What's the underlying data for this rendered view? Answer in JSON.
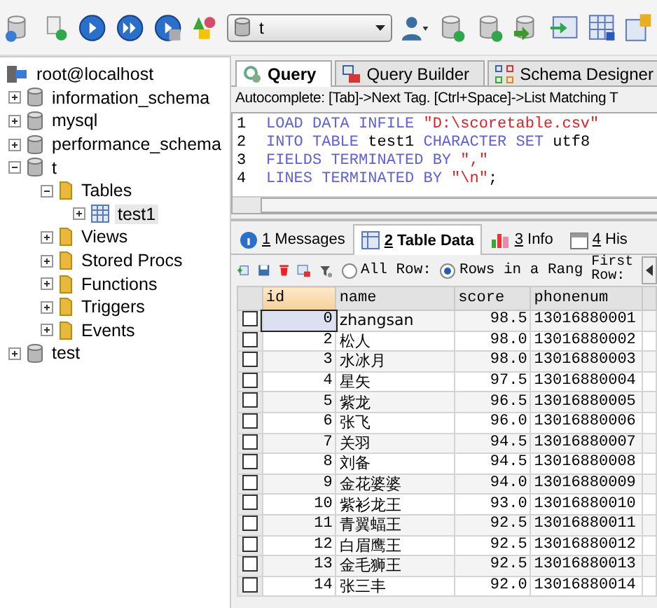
{
  "toolbar": {
    "database_select": {
      "value": "t"
    }
  },
  "tree": [
    {
      "label": "root@localhost",
      "kind": "server",
      "selected": false,
      "children": [
        {
          "label": "information_schema",
          "kind": "database",
          "expanded": false,
          "selected": false
        },
        {
          "label": "mysql",
          "kind": "database",
          "expanded": false,
          "selected": false
        },
        {
          "label": "performance_schema",
          "kind": "database",
          "expanded": false,
          "selected": false
        },
        {
          "label": "t",
          "kind": "database",
          "expanded": true,
          "selected": false,
          "children": [
            {
              "label": "Tables",
              "kind": "folder",
              "expanded": true,
              "selected": false,
              "children": [
                {
                  "label": "test1",
                  "kind": "table",
                  "expanded": false,
                  "selected": true
                }
              ]
            },
            {
              "label": "Views",
              "kind": "folder",
              "expanded": false,
              "selected": false
            },
            {
              "label": "Stored Procs",
              "kind": "folder",
              "expanded": false,
              "selected": false
            },
            {
              "label": "Functions",
              "kind": "folder",
              "expanded": false,
              "selected": false
            },
            {
              "label": "Triggers",
              "kind": "folder",
              "expanded": false,
              "selected": false
            },
            {
              "label": "Events",
              "kind": "folder",
              "expanded": false,
              "selected": false
            }
          ]
        },
        {
          "label": "test",
          "kind": "database",
          "expanded": false,
          "selected": false
        }
      ]
    }
  ],
  "query_tabs": [
    {
      "label": "Query",
      "selected": true
    },
    {
      "label": "Query Builder",
      "selected": false
    },
    {
      "label": "Schema Designer",
      "selected": false
    }
  ],
  "autocomplete_hint": "Autocomplete: [Tab]->Next Tag. [Ctrl+Space]->List Matching T",
  "editor_lines": [
    {
      "number": "1",
      "tokens": [
        {
          "text": "LOAD DATA INFILE ",
          "kind": "keyword"
        },
        {
          "text": "\"D:\\scoretable.csv\"",
          "kind": "string"
        }
      ]
    },
    {
      "number": "2",
      "tokens": [
        {
          "text": "INTO TABLE ",
          "kind": "keyword"
        },
        {
          "text": "test1 ",
          "kind": "plain"
        },
        {
          "text": "CHARACTER SET ",
          "kind": "keyword"
        },
        {
          "text": "utf8",
          "kind": "plain"
        }
      ]
    },
    {
      "number": "3",
      "tokens": [
        {
          "text": "FIELDS TERMINATED BY ",
          "kind": "keyword"
        },
        {
          "text": "\",\"",
          "kind": "string"
        }
      ]
    },
    {
      "number": "4",
      "tokens": [
        {
          "text": "LINES TERMINATED BY ",
          "kind": "keyword"
        },
        {
          "text": "\"\\n\"",
          "kind": "string"
        },
        {
          "text": ";",
          "kind": "plain"
        }
      ]
    }
  ],
  "result_tabs": [
    {
      "hotkey": "1",
      "label": " Messages",
      "selected": false
    },
    {
      "hotkey": "2",
      "label": " Table Data",
      "selected": true
    },
    {
      "hotkey": "3",
      "label": " Info",
      "selected": false
    },
    {
      "hotkey": "4",
      "label": " His",
      "selected": false
    }
  ],
  "row_options": [
    {
      "label": "All Row:",
      "selected": false
    },
    {
      "label": "Rows in a Rang",
      "selected": true
    }
  ],
  "first_row_label": "First Row:",
  "columns": [
    "id",
    "name",
    "score",
    "phonenum"
  ],
  "rows": [
    {
      "checked": false,
      "selected": true,
      "cells": [
        "0",
        "zhangsan",
        "98.5",
        "13016880001"
      ]
    },
    {
      "checked": false,
      "selected": false,
      "cells": [
        "2",
        "松人",
        "98.0",
        "13016880002"
      ]
    },
    {
      "checked": false,
      "selected": false,
      "cells": [
        "3",
        "水冰月",
        "98.0",
        "13016880003"
      ]
    },
    {
      "checked": false,
      "selected": false,
      "cells": [
        "4",
        "星矢",
        "97.5",
        "13016880004"
      ]
    },
    {
      "checked": false,
      "selected": false,
      "cells": [
        "5",
        "紫龙",
        "96.5",
        "13016880005"
      ]
    },
    {
      "checked": false,
      "selected": false,
      "cells": [
        "6",
        "张飞",
        "96.0",
        "13016880006"
      ]
    },
    {
      "checked": false,
      "selected": false,
      "cells": [
        "7",
        "关羽",
        "94.5",
        "13016880007"
      ]
    },
    {
      "checked": false,
      "selected": false,
      "cells": [
        "8",
        "刘备",
        "94.5",
        "13016880008"
      ]
    },
    {
      "checked": false,
      "selected": false,
      "cells": [
        "9",
        "金花婆婆",
        "94.0",
        "13016880009"
      ]
    },
    {
      "checked": false,
      "selected": false,
      "cells": [
        "10",
        "紫衫龙王",
        "93.0",
        "13016880010"
      ]
    },
    {
      "checked": false,
      "selected": false,
      "cells": [
        "11",
        "青翼蝠王",
        "92.5",
        "13016880011"
      ]
    },
    {
      "checked": false,
      "selected": false,
      "cells": [
        "12",
        "白眉鹰王",
        "92.5",
        "13016880012"
      ]
    },
    {
      "checked": false,
      "selected": false,
      "cells": [
        "13",
        "金毛狮王",
        "92.5",
        "13016880013"
      ]
    },
    {
      "checked": false,
      "selected": false,
      "cells": [
        "14",
        "张三丰",
        "92.0",
        "13016880014"
      ]
    }
  ]
}
